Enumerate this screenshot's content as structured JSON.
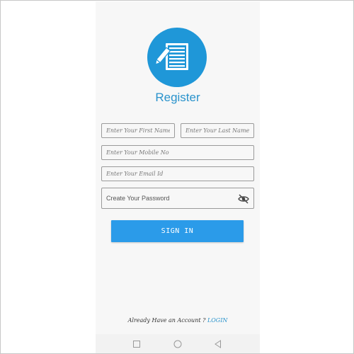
{
  "app": {
    "title": "Register"
  },
  "icons": {
    "logo": "register-document-pencil-icon",
    "eye": "eye-off-icon"
  },
  "colors": {
    "accent": "#1f97d8",
    "button": "#2b9be9",
    "link": "#2a93cc"
  },
  "form": {
    "first_name": {
      "placeholder": "Enter Your First Name",
      "value": ""
    },
    "last_name": {
      "placeholder": "Enter Your Last Name",
      "value": ""
    },
    "mobile": {
      "placeholder": "Enter Your Mobile No",
      "value": ""
    },
    "email": {
      "placeholder": "Enter Your Email Id",
      "value": ""
    },
    "password": {
      "placeholder": "Create Your Password",
      "value": ""
    }
  },
  "button": {
    "label": "SIGN IN"
  },
  "footer": {
    "prompt": "Already Have an Account ? ",
    "link": "LOGIN"
  },
  "navbar": {
    "items": [
      "recent-apps",
      "home",
      "back"
    ]
  }
}
